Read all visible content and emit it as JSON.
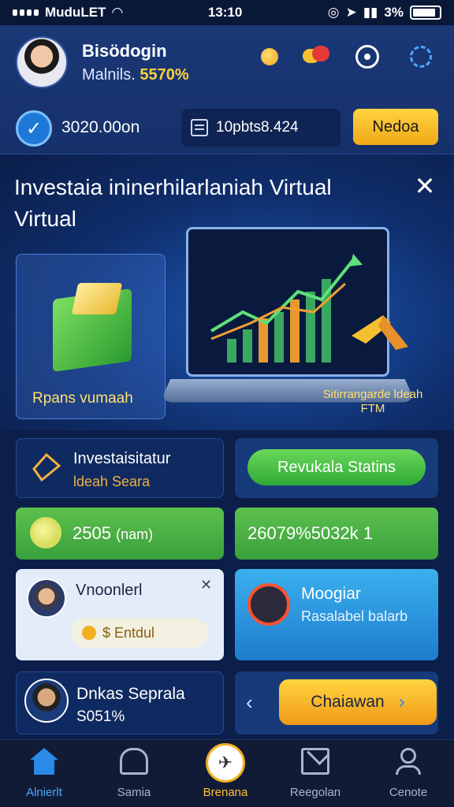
{
  "status_bar": {
    "carrier": "MuduLET",
    "time": "13:10",
    "battery_pct": "3%"
  },
  "header": {
    "user_name": "Bisödogin",
    "user_sub_label": "Malnils.",
    "user_sub_value": "5570%",
    "balance": "3020.00on",
    "points": "10pbts8.424",
    "action_label": "Nedoa",
    "icons": [
      "coin-icon",
      "chat-icon",
      "target-icon",
      "refresh-icon"
    ]
  },
  "hero": {
    "title": "Investaia ininerhilarlaniah Virtual Virtual",
    "left_label": "Rpans vumaah",
    "right_label": "Sitirrangarde ldeah FTM",
    "colors": {
      "accent": "#ffe070",
      "background": "#0f2d6a"
    }
  },
  "tiles": {
    "invest_title": "Investaisitatur",
    "invest_sub": "ldeah Seara",
    "status_button": "Revukala Statins",
    "green_left_value": "2505",
    "green_left_unit": "(nam)",
    "green_right_value": "26079%5032k 1",
    "profile_name": "Vnoonlerl",
    "entry_label": "$ Entdul",
    "blue_title": "Moogiar",
    "blue_sub": "Rasalabel balarb",
    "person_name": "Dnkas Seprala",
    "person_value": "S051%",
    "start_button": "Chaiawan"
  },
  "bottom_nav": [
    {
      "label": "Alnierlt",
      "icon": "home-icon",
      "active": true
    },
    {
      "label": "Samia",
      "icon": "bell-icon",
      "active": false
    },
    {
      "label": "Brenana",
      "icon": "center-action-icon",
      "active": false
    },
    {
      "label": "Reegolan",
      "icon": "mail-icon",
      "active": false
    },
    {
      "label": "Cenote",
      "icon": "user-icon",
      "active": false
    }
  ]
}
